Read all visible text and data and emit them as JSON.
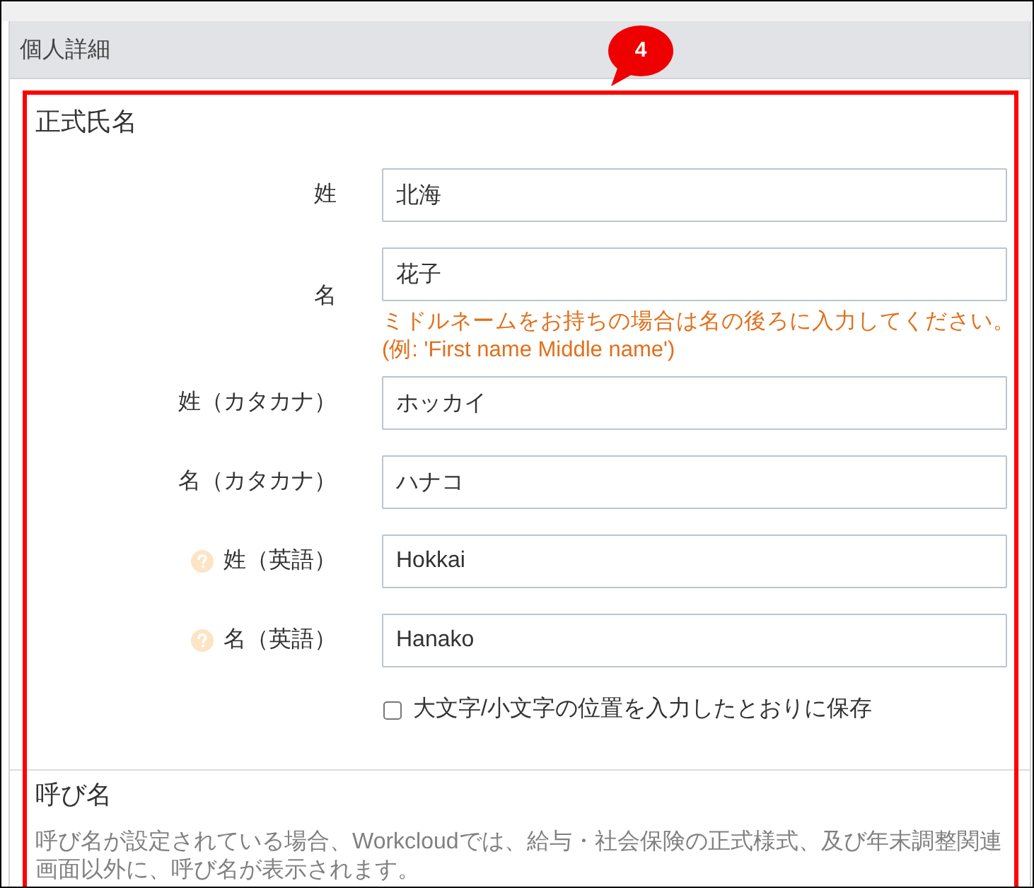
{
  "section": {
    "title": "個人詳細"
  },
  "annotation": {
    "number": "4"
  },
  "legal_name": {
    "heading": "正式氏名",
    "fields": [
      {
        "label": "姓",
        "value": "北海",
        "help": false
      },
      {
        "label": "名",
        "value": "花子",
        "help": false,
        "hint": [
          "ミドルネームをお持ちの場合は名の後ろに入力してください。",
          "(例: 'First name Middle name')"
        ]
      },
      {
        "label": "姓（カタカナ）",
        "value": "ホッカイ",
        "help": false
      },
      {
        "label": "名（カタカナ）",
        "value": "ハナコ",
        "help": false
      },
      {
        "label": "姓（英語）",
        "value": "Hokkai",
        "help": true
      },
      {
        "label": "名（英語）",
        "value": "Hanako",
        "help": true
      }
    ],
    "case_option": {
      "label": "大文字/小文字の位置を入力したとおりに保存",
      "checked": false
    }
  },
  "nickname": {
    "heading": "呼び名",
    "description": "呼び名が設定されている場合、Workcloudでは、給与・社会保険の正式様式、及び年末調整関連画面以外に、呼び名が表示されます。"
  }
}
